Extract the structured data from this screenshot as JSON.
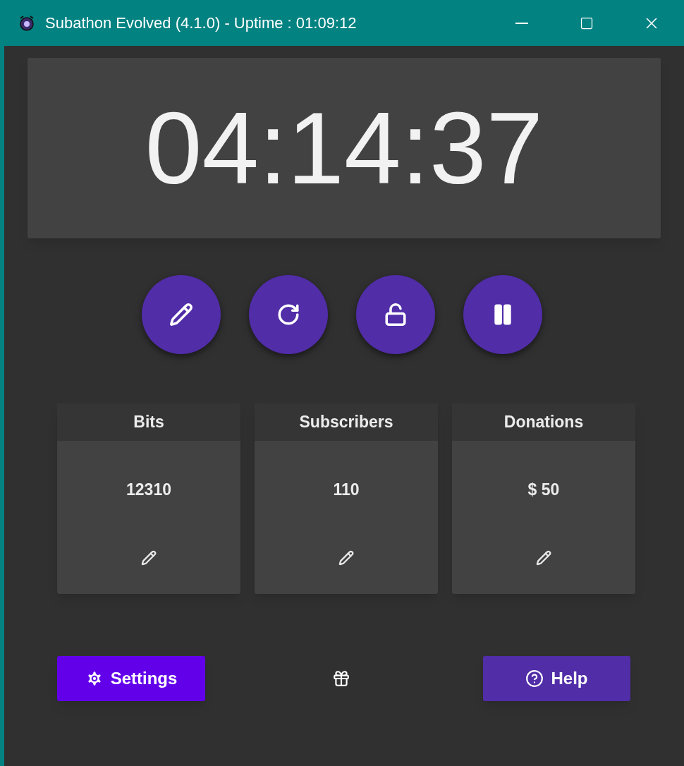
{
  "window": {
    "title": "Subathon Evolved (4.1.0) - Uptime : 01:09:12"
  },
  "timer": "04:14:37",
  "counters": [
    {
      "label": "Bits",
      "value": "12310"
    },
    {
      "label": "Subscribers",
      "value": "110"
    },
    {
      "label": "Donations",
      "value": "$ 50"
    }
  ],
  "buttons": {
    "settings": "Settings",
    "help": "Help"
  }
}
